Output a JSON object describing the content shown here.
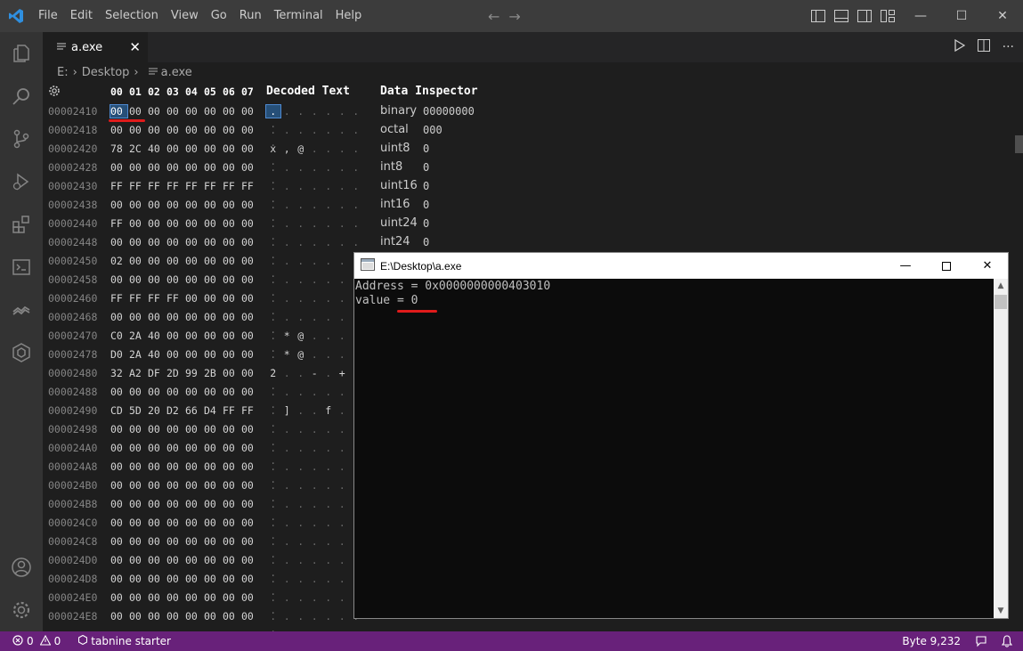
{
  "titlebar": {
    "menu": [
      "File",
      "Edit",
      "Selection",
      "View",
      "Go",
      "Run",
      "Terminal",
      "Help"
    ]
  },
  "tab": {
    "label": "a.exe"
  },
  "breadcrumb": {
    "drive": "E:",
    "folder": "Desktop",
    "file": "a.exe"
  },
  "hex": {
    "columns": [
      "00",
      "01",
      "02",
      "03",
      "04",
      "05",
      "06",
      "07"
    ],
    "decoded_title": "Decoded Text",
    "inspector_title": "Data Inspector",
    "rows": [
      {
        "addr": "00002410",
        "bytes": [
          "00",
          "00",
          "00",
          "00",
          "00",
          "00",
          "00",
          "00"
        ],
        "dec": [
          ".",
          ".",
          ".",
          ".",
          ".",
          ".",
          ".",
          "."
        ]
      },
      {
        "addr": "00002418",
        "bytes": [
          "00",
          "00",
          "00",
          "00",
          "00",
          "00",
          "00",
          "00"
        ],
        "dec": [
          ".",
          ".",
          ".",
          ".",
          ".",
          ".",
          ".",
          "."
        ]
      },
      {
        "addr": "00002420",
        "bytes": [
          "78",
          "2C",
          "40",
          "00",
          "00",
          "00",
          "00",
          "00"
        ],
        "dec": [
          "x",
          ",",
          "@",
          ".",
          ".",
          ".",
          ".",
          "."
        ]
      },
      {
        "addr": "00002428",
        "bytes": [
          "00",
          "00",
          "00",
          "00",
          "00",
          "00",
          "00",
          "00"
        ],
        "dec": [
          ".",
          ".",
          ".",
          ".",
          ".",
          ".",
          ".",
          "."
        ]
      },
      {
        "addr": "00002430",
        "bytes": [
          "FF",
          "FF",
          "FF",
          "FF",
          "FF",
          "FF",
          "FF",
          "FF"
        ],
        "dec": [
          ".",
          ".",
          ".",
          ".",
          ".",
          ".",
          ".",
          "."
        ]
      },
      {
        "addr": "00002438",
        "bytes": [
          "00",
          "00",
          "00",
          "00",
          "00",
          "00",
          "00",
          "00"
        ],
        "dec": [
          ".",
          ".",
          ".",
          ".",
          ".",
          ".",
          ".",
          "."
        ]
      },
      {
        "addr": "00002440",
        "bytes": [
          "FF",
          "00",
          "00",
          "00",
          "00",
          "00",
          "00",
          "00"
        ],
        "dec": [
          ".",
          ".",
          ".",
          ".",
          ".",
          ".",
          ".",
          "."
        ]
      },
      {
        "addr": "00002448",
        "bytes": [
          "00",
          "00",
          "00",
          "00",
          "00",
          "00",
          "00",
          "00"
        ],
        "dec": [
          ".",
          ".",
          ".",
          ".",
          ".",
          ".",
          ".",
          "."
        ]
      },
      {
        "addr": "00002450",
        "bytes": [
          "02",
          "00",
          "00",
          "00",
          "00",
          "00",
          "00",
          "00"
        ],
        "dec": [
          ".",
          ".",
          ".",
          ".",
          ".",
          ".",
          ".",
          "."
        ]
      },
      {
        "addr": "00002458",
        "bytes": [
          "00",
          "00",
          "00",
          "00",
          "00",
          "00",
          "00",
          "00"
        ],
        "dec": [
          ".",
          ".",
          ".",
          ".",
          ".",
          ".",
          ".",
          "."
        ]
      },
      {
        "addr": "00002460",
        "bytes": [
          "FF",
          "FF",
          "FF",
          "FF",
          "00",
          "00",
          "00",
          "00"
        ],
        "dec": [
          ".",
          ".",
          ".",
          ".",
          ".",
          ".",
          ".",
          "."
        ]
      },
      {
        "addr": "00002468",
        "bytes": [
          "00",
          "00",
          "00",
          "00",
          "00",
          "00",
          "00",
          "00"
        ],
        "dec": [
          ".",
          ".",
          ".",
          ".",
          ".",
          ".",
          ".",
          "."
        ]
      },
      {
        "addr": "00002470",
        "bytes": [
          "C0",
          "2A",
          "40",
          "00",
          "00",
          "00",
          "00",
          "00"
        ],
        "dec": [
          ".",
          "*",
          "@",
          ".",
          ".",
          ".",
          ".",
          "."
        ]
      },
      {
        "addr": "00002478",
        "bytes": [
          "D0",
          "2A",
          "40",
          "00",
          "00",
          "00",
          "00",
          "00"
        ],
        "dec": [
          ".",
          "*",
          "@",
          ".",
          ".",
          ".",
          ".",
          "."
        ]
      },
      {
        "addr": "00002480",
        "bytes": [
          "32",
          "A2",
          "DF",
          "2D",
          "99",
          "2B",
          "00",
          "00"
        ],
        "dec": [
          "2",
          ".",
          ".",
          "-",
          ".",
          "+",
          ".",
          "."
        ]
      },
      {
        "addr": "00002488",
        "bytes": [
          "00",
          "00",
          "00",
          "00",
          "00",
          "00",
          "00",
          "00"
        ],
        "dec": [
          ".",
          ".",
          ".",
          ".",
          ".",
          ".",
          ".",
          "."
        ]
      },
      {
        "addr": "00002490",
        "bytes": [
          "CD",
          "5D",
          "20",
          "D2",
          "66",
          "D4",
          "FF",
          "FF"
        ],
        "dec": [
          ".",
          "]",
          ".",
          ".",
          "f",
          ".",
          ".",
          "."
        ]
      },
      {
        "addr": "00002498",
        "bytes": [
          "00",
          "00",
          "00",
          "00",
          "00",
          "00",
          "00",
          "00"
        ],
        "dec": [
          ".",
          ".",
          ".",
          ".",
          ".",
          ".",
          ".",
          "."
        ]
      },
      {
        "addr": "000024A0",
        "bytes": [
          "00",
          "00",
          "00",
          "00",
          "00",
          "00",
          "00",
          "00"
        ],
        "dec": [
          ".",
          ".",
          ".",
          ".",
          ".",
          ".",
          ".",
          "."
        ]
      },
      {
        "addr": "000024A8",
        "bytes": [
          "00",
          "00",
          "00",
          "00",
          "00",
          "00",
          "00",
          "00"
        ],
        "dec": [
          ".",
          ".",
          ".",
          ".",
          ".",
          ".",
          ".",
          "."
        ]
      },
      {
        "addr": "000024B0",
        "bytes": [
          "00",
          "00",
          "00",
          "00",
          "00",
          "00",
          "00",
          "00"
        ],
        "dec": [
          ".",
          ".",
          ".",
          ".",
          ".",
          ".",
          ".",
          "."
        ]
      },
      {
        "addr": "000024B8",
        "bytes": [
          "00",
          "00",
          "00",
          "00",
          "00",
          "00",
          "00",
          "00"
        ],
        "dec": [
          ".",
          ".",
          ".",
          ".",
          ".",
          ".",
          ".",
          "."
        ]
      },
      {
        "addr": "000024C0",
        "bytes": [
          "00",
          "00",
          "00",
          "00",
          "00",
          "00",
          "00",
          "00"
        ],
        "dec": [
          ".",
          ".",
          ".",
          ".",
          ".",
          ".",
          ".",
          "."
        ]
      },
      {
        "addr": "000024C8",
        "bytes": [
          "00",
          "00",
          "00",
          "00",
          "00",
          "00",
          "00",
          "00"
        ],
        "dec": [
          ".",
          ".",
          ".",
          ".",
          ".",
          ".",
          ".",
          "."
        ]
      },
      {
        "addr": "000024D0",
        "bytes": [
          "00",
          "00",
          "00",
          "00",
          "00",
          "00",
          "00",
          "00"
        ],
        "dec": [
          ".",
          ".",
          ".",
          ".",
          ".",
          ".",
          ".",
          "."
        ]
      },
      {
        "addr": "000024D8",
        "bytes": [
          "00",
          "00",
          "00",
          "00",
          "00",
          "00",
          "00",
          "00"
        ],
        "dec": [
          ".",
          ".",
          ".",
          ".",
          ".",
          ".",
          ".",
          "."
        ]
      },
      {
        "addr": "000024E0",
        "bytes": [
          "00",
          "00",
          "00",
          "00",
          "00",
          "00",
          "00",
          "00"
        ],
        "dec": [
          ".",
          ".",
          ".",
          ".",
          ".",
          ".",
          ".",
          "."
        ]
      },
      {
        "addr": "000024E8",
        "bytes": [
          "00",
          "00",
          "00",
          "00",
          "00",
          "00",
          "00",
          "00"
        ],
        "dec": [
          ".",
          ".",
          ".",
          ".",
          ".",
          ".",
          ".",
          "."
        ]
      }
    ],
    "inspector": [
      {
        "key": "binary",
        "value": "00000000"
      },
      {
        "key": "octal",
        "value": "000"
      },
      {
        "key": "uint8",
        "value": "0"
      },
      {
        "key": "int8",
        "value": "0"
      },
      {
        "key": "uint16",
        "value": "0"
      },
      {
        "key": "int16",
        "value": "0"
      },
      {
        "key": "uint24",
        "value": "0"
      },
      {
        "key": "int24",
        "value": "0"
      }
    ]
  },
  "console": {
    "title": "E:\\Desktop\\a.exe",
    "lines": [
      "Address = 0x0000000000403010",
      "value = 0"
    ]
  },
  "statusbar": {
    "errors": "0",
    "warnings": "0",
    "tabnine": "tabnine starter",
    "byte": "Byte 9,232"
  },
  "colors": {
    "accent_vscode": "#0078d4",
    "statusbar": "#68217a",
    "annotation": "#e01b1b"
  }
}
